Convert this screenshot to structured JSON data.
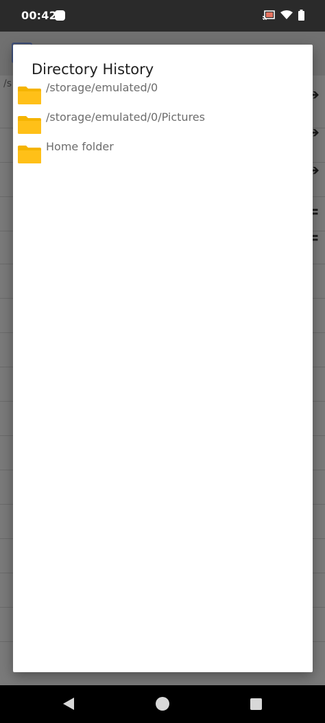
{
  "status_bar": {
    "time": "00:42",
    "icons": [
      "cast-icon",
      "wifi-icon",
      "battery-icon"
    ]
  },
  "background": {
    "path_fragment": "/s",
    "row_arrows": [
      "➔",
      "➔",
      "➔"
    ],
    "row_menu": [
      "=",
      "="
    ]
  },
  "dialog": {
    "title": "Directory History",
    "items": [
      {
        "label": "/storage/emulated/0"
      },
      {
        "label": "/storage/emulated/0/Pictures"
      },
      {
        "label": "Home folder"
      }
    ]
  },
  "colors": {
    "folder": "#FFC018",
    "folder_tab": "#F5B400",
    "nav_bar": "#000000",
    "status_bar": "#2A2A2A"
  }
}
